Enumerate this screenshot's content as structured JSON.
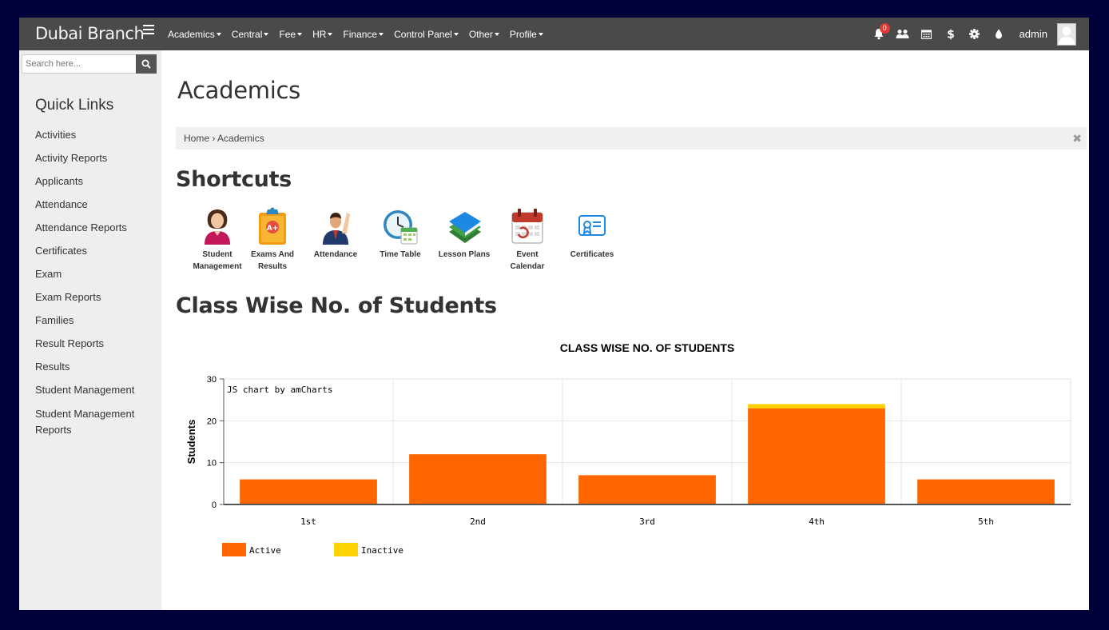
{
  "topbar": {
    "brand": "Dubai Branch",
    "menu": [
      {
        "label": "Academics"
      },
      {
        "label": "Central"
      },
      {
        "label": "Fee"
      },
      {
        "label": "HR"
      },
      {
        "label": "Finance"
      },
      {
        "label": "Control Panel"
      },
      {
        "label": "Other"
      },
      {
        "label": "Profile"
      }
    ],
    "notification_count": "0",
    "icons": [
      "bell-icon",
      "users-icon",
      "calendar-icon",
      "dollar-icon",
      "gear-icon",
      "tint-icon"
    ],
    "user": "admin"
  },
  "sidebar": {
    "search_placeholder": "Search here...",
    "quick_links_title": "Quick Links",
    "items": [
      "Activities",
      "Activity Reports",
      "Applicants",
      "Attendance",
      "Attendance Reports",
      "Certificates",
      "Exam",
      "Exam Reports",
      "Families",
      "Result Reports",
      "Results",
      "Student Management",
      "Student Management Reports"
    ]
  },
  "main": {
    "title": "Academics",
    "breadcrumb": {
      "home": "Home",
      "separator": "›",
      "current": "Academics"
    },
    "shortcuts_title": "Shortcuts",
    "shortcuts": [
      {
        "label_line1": "Student",
        "label_line2": "Management",
        "icon": "student-icon"
      },
      {
        "label_line1": "Exams And",
        "label_line2": "Results",
        "icon": "exam-clipboard-icon"
      },
      {
        "label_line1": "Attendance",
        "label_line2": "",
        "icon": "attendance-icon"
      },
      {
        "label_line1": "Time Table",
        "label_line2": "",
        "icon": "clock-calendar-icon"
      },
      {
        "label_line1": "Lesson Plans",
        "label_line2": "",
        "icon": "books-icon"
      },
      {
        "label_line1": "Event",
        "label_line2": "Calendar",
        "icon": "event-calendar-icon"
      },
      {
        "label_line1": "Certificates",
        "label_line2": "",
        "icon": "certificate-icon"
      }
    ],
    "chart_section_title": "Class Wise No. of Students"
  },
  "colors": {
    "topbar": "#4a4a4a",
    "sidebar": "#eeeeee",
    "active": "#ff6600",
    "inactive": "#fcd202",
    "frame_border": "#00003a"
  },
  "chart_data": {
    "type": "bar",
    "stacked": true,
    "title": "CLASS WISE NO. OF STUDENTS",
    "watermark": "JS chart by amCharts",
    "ylabel": "Students",
    "xlabel": "",
    "ylim": [
      0,
      30
    ],
    "yticks": [
      0,
      10,
      20,
      30
    ],
    "grid": true,
    "legend_position": "bottom-left",
    "categories": [
      "1st",
      "2nd",
      "3rd",
      "4th",
      "5th"
    ],
    "series": [
      {
        "name": "Active",
        "color": "#ff6600",
        "values": [
          6,
          12,
          7,
          23,
          6
        ]
      },
      {
        "name": "Inactive",
        "color": "#fcd202",
        "values": [
          0,
          0,
          0,
          1,
          0
        ]
      }
    ]
  }
}
